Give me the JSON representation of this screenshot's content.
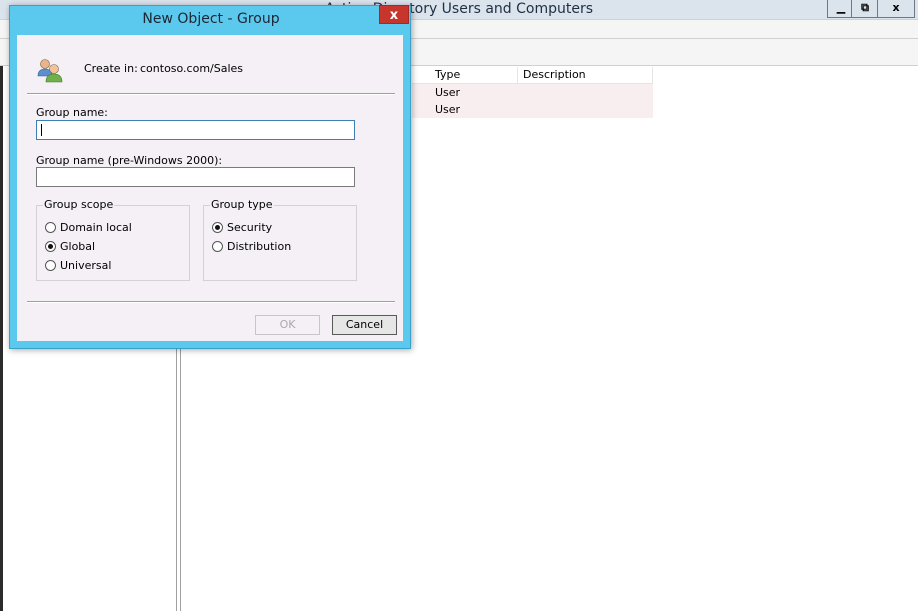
{
  "main_window": {
    "title": "Active Directory Users and Computers",
    "controls": {
      "minimize": "▁",
      "restore": "⧉",
      "close": "x"
    },
    "list": {
      "columns": [
        "Type",
        "Description"
      ],
      "rows": [
        {
          "type": "User",
          "description": ""
        },
        {
          "type": "User",
          "description": ""
        }
      ]
    }
  },
  "dialog": {
    "title": "New Object - Group",
    "close_label": "x",
    "create_in_label": "Create in:",
    "create_in_value": "contoso.com/Sales",
    "group_name_label": "Group name:",
    "group_name_value": "",
    "group_name_pre2000_label": "Group name (pre-Windows 2000):",
    "group_name_pre2000_value": "",
    "group_scope": {
      "legend": "Group scope",
      "options": [
        {
          "label": "Domain local",
          "selected": false
        },
        {
          "label": "Global",
          "selected": true
        },
        {
          "label": "Universal",
          "selected": false
        }
      ]
    },
    "group_type": {
      "legend": "Group type",
      "options": [
        {
          "label": "Security",
          "selected": true
        },
        {
          "label": "Distribution",
          "selected": false
        }
      ]
    },
    "ok_label": "OK",
    "ok_enabled": false,
    "cancel_label": "Cancel"
  },
  "icons": {
    "dialog_icon": "users-group-icon"
  },
  "colors": {
    "dialog_frame": "#5bc9ee",
    "close_button": "#c6362c",
    "dialog_body": "#f4f0f5",
    "list_row_bg": "#f8eef0"
  }
}
